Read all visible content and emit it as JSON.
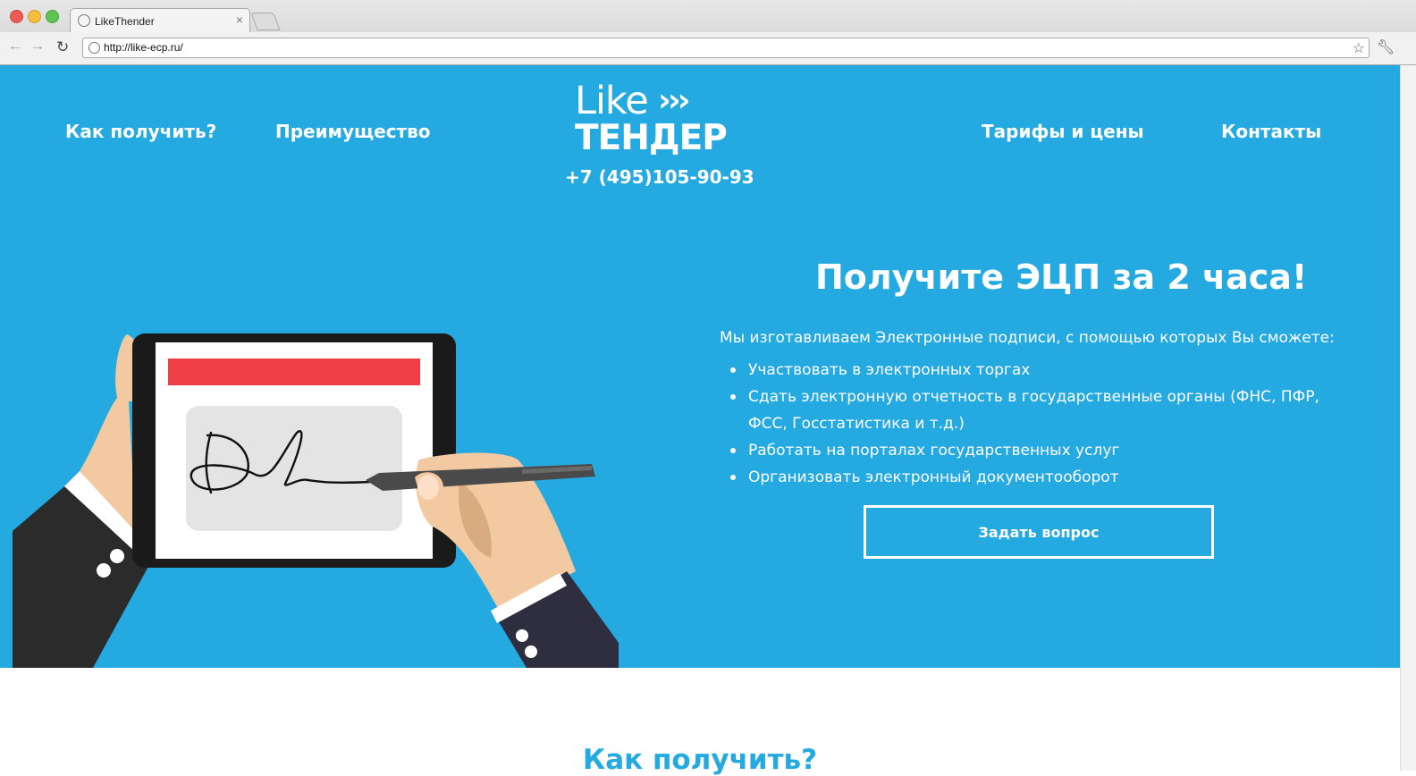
{
  "browser": {
    "tab_title": "LikeThender",
    "url": "http://like-ecp.ru/"
  },
  "site": {
    "nav": {
      "how": "Как получить?",
      "advantage": "Преимущество",
      "prices": "Тарифы и цены",
      "contacts": "Контакты"
    },
    "logo": {
      "like": "Like",
      "arrows": "›››",
      "tender": "ТЕНДЕР"
    },
    "phone": "+7 (495)105-90-93"
  },
  "hero": {
    "heading": "Получите ЭЦП за 2 часа!",
    "intro": "Мы изготавливаем Электронные подписи, с помощью которых Вы сможете:",
    "benefits": [
      "Участвовать в электронных торгах",
      "Сдать электронную отчетность в государственные органы (ФНС, ПФР, ФСС, Госстатистика и т.д.)",
      "Работать на порталах государственных услуг",
      "Организовать электронный документооборот"
    ],
    "button_label": "Задать вопрос"
  },
  "section": {
    "title": "Как получить?"
  },
  "colors": {
    "brand_blue": "#24a9e1",
    "accent_red": "#ef3e46"
  },
  "icons": [
    "globe-icon",
    "close-icon",
    "back-arrow-icon",
    "forward-arrow-icon",
    "reload-icon",
    "star-icon",
    "wrench-icon"
  ]
}
